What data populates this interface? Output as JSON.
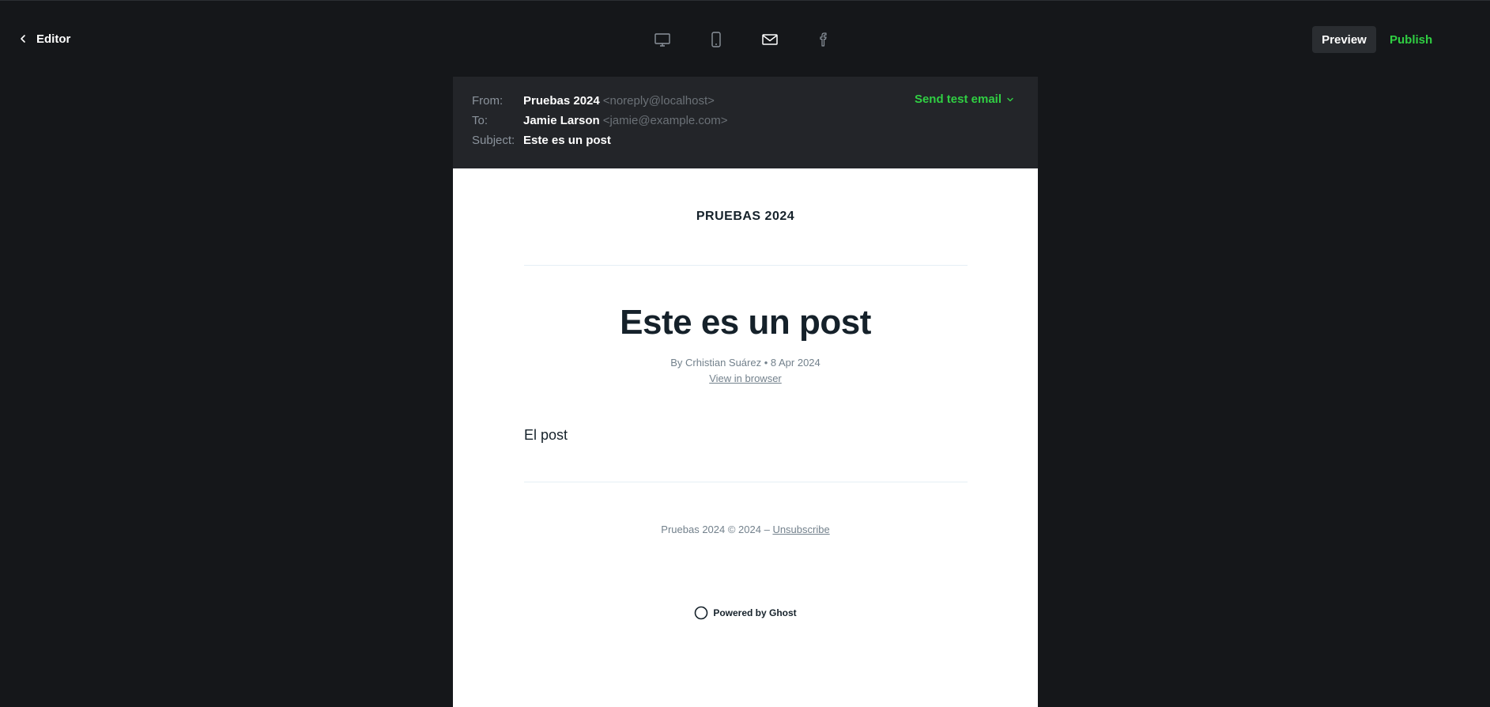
{
  "header": {
    "back_label": "Editor",
    "modes": [
      {
        "icon": "desktop-icon",
        "active": false
      },
      {
        "icon": "mobile-icon",
        "active": false
      },
      {
        "icon": "email-icon",
        "active": true
      },
      {
        "icon": "facebook-icon",
        "active": false
      }
    ],
    "preview_label": "Preview",
    "publish_label": "Publish"
  },
  "meta": {
    "from_label": "From:",
    "from_name": "Pruebas 2024",
    "from_addr": "<noreply@localhost>",
    "to_label": "To:",
    "to_name": "Jamie Larson",
    "to_addr": "<jamie@example.com>",
    "subject_label": "Subject:",
    "subject": "Este es un post",
    "send_test_label": "Send test email"
  },
  "email": {
    "site_title": "PRUEBAS 2024",
    "post_title": "Este es un post",
    "byline": "By Crhistian Suárez • 8 Apr 2024",
    "view_in_browser": "View in browser",
    "content": "El post",
    "footer_text": "Pruebas 2024 © 2024 – ",
    "unsubscribe": "Unsubscribe",
    "powered_by": "Powered by Ghost"
  },
  "colors": {
    "background": "#15171a",
    "panel": "#232529",
    "accent": "#30cf43",
    "text_muted": "#73818c"
  }
}
